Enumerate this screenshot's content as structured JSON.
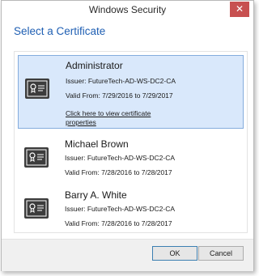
{
  "window": {
    "title": "Windows Security",
    "close_glyph": "✕"
  },
  "heading": "Select a Certificate",
  "certificates": [
    {
      "name": "Administrator",
      "issuer": "Issuer: FutureTech-AD-WS-DC2-CA",
      "valid": "Valid From: 7/29/2016 to 7/29/2017",
      "link_line1": "Click here to view certificate",
      "link_line2": "properties",
      "icon": "certificate-icon"
    },
    {
      "name": "Michael Brown",
      "issuer": "Issuer: FutureTech-AD-WS-DC2-CA",
      "valid": "Valid From: 7/28/2016 to 7/28/2017",
      "icon": "certificate-icon"
    },
    {
      "name": "Barry A. White",
      "issuer": "Issuer: FutureTech-AD-WS-DC2-CA",
      "valid": "Valid From: 7/28/2016 to 7/28/2017",
      "icon": "certificate-icon"
    }
  ],
  "buttons": {
    "ok": "OK",
    "cancel": "Cancel"
  },
  "colors": {
    "heading": "#1f5fb3",
    "selection_bg": "#d9e8fb",
    "selection_border": "#84acdd",
    "close_button": "#c75050"
  }
}
